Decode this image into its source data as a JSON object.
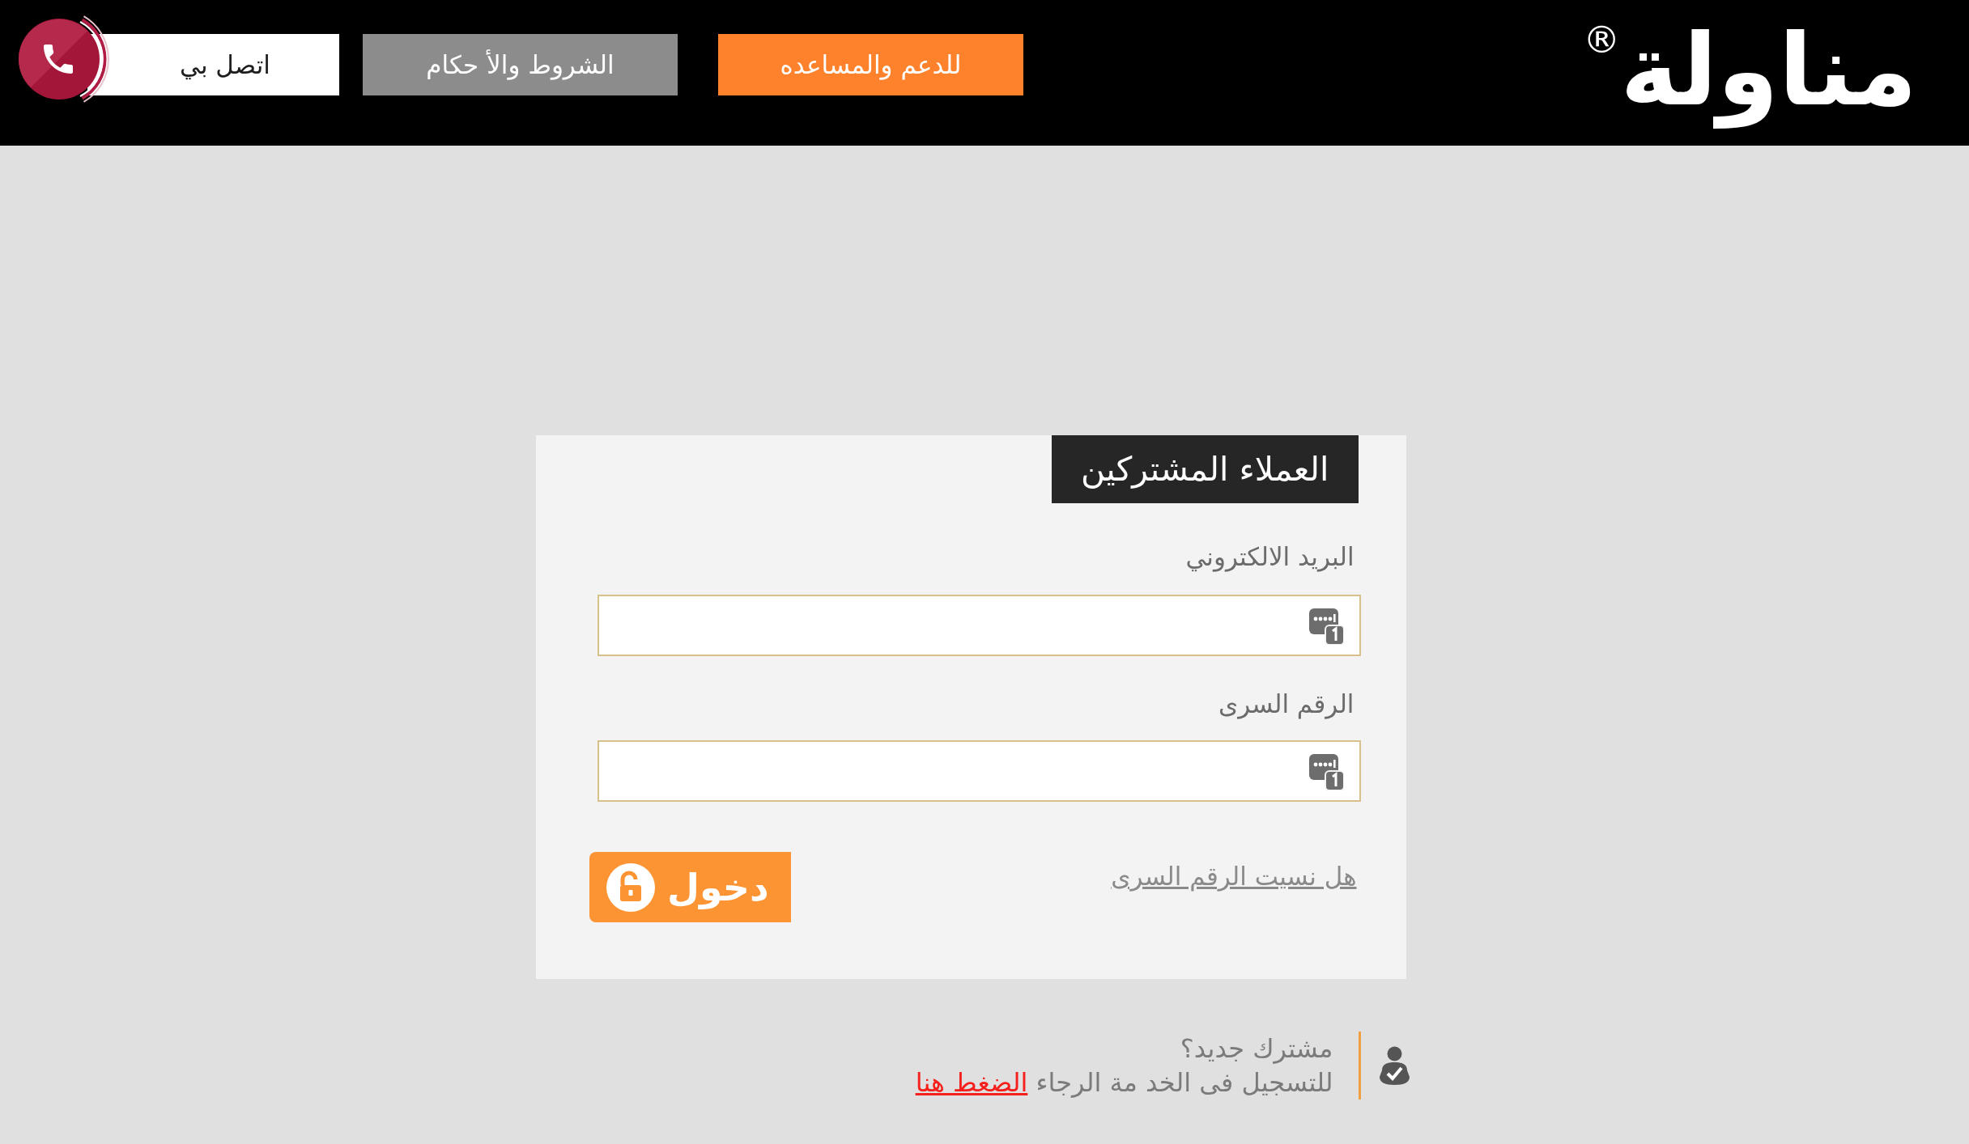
{
  "header": {
    "logo": {
      "text": "مناولة",
      "mark": "®"
    },
    "buttons": [
      {
        "label": "للدعم والمساعده",
        "kind": "primary"
      },
      {
        "label": "الشروط والأ حكام",
        "kind": "secondary"
      },
      {
        "label": "اتصل بي",
        "kind": "call"
      }
    ]
  },
  "login": {
    "title": "العملاء المشتركين",
    "fields": [
      {
        "label": "البريد الالكتروني"
      },
      {
        "label": "الرقم السرى"
      }
    ],
    "submit": "دخول",
    "forgot_link": "هل نسيت الرقم السرى"
  },
  "signup": {
    "question": "مشترك جديد؟",
    "text": "للتسجيل فى الخد مة الرجاء",
    "link": "الضغط هنا"
  }
}
